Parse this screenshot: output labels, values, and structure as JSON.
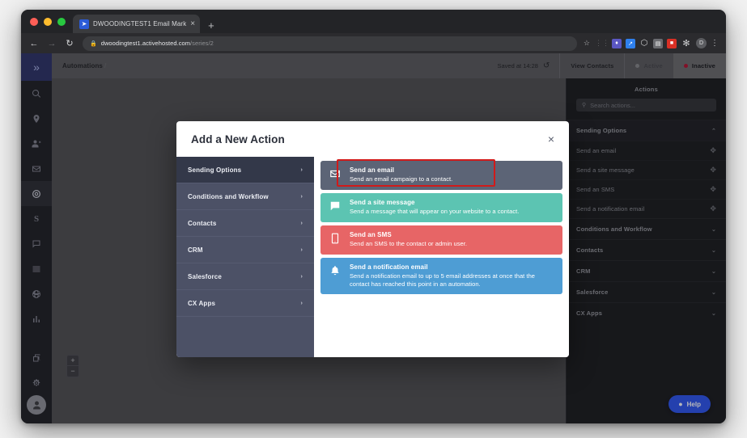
{
  "browser": {
    "tab": {
      "title": "DWOODINGTEST1 Email Mark",
      "favicon": "➤",
      "close": "×"
    },
    "new_tab": "+",
    "nav": {
      "back": "←",
      "forward": "→",
      "reload": "↻"
    },
    "omnibox": {
      "lock": "🔒",
      "domain": "dwoodingtest1.activehosted.com",
      "path": "/series/2"
    },
    "star": "☆",
    "extensions": [
      {
        "name": "extension-icon-1",
        "glyph": "◆",
        "cls": "e1"
      },
      {
        "name": "extension-icon-2",
        "glyph": "↗",
        "cls": "e2"
      },
      {
        "name": "extension-icon-3",
        "glyph": "⬡",
        "cls": "e3"
      },
      {
        "name": "extension-icon-4",
        "glyph": "▤",
        "cls": "e4"
      },
      {
        "name": "extension-icon-5",
        "glyph": "PDF",
        "cls": "e5"
      }
    ],
    "puzzle": "🧩",
    "profile_initial": "D",
    "kebab": "⋮"
  },
  "app_header": {
    "breadcrumb": "Automations",
    "breadcrumb_separator": "/",
    "saved_status": "Saved at 14:28",
    "history_icon": "↺",
    "view_contacts": "View Contacts",
    "active_label": "Active",
    "inactive_label": "Inactive"
  },
  "left_rail": {
    "logo": "»",
    "items": [
      {
        "name": "sidebar-icon-search",
        "glyph": "search"
      },
      {
        "name": "sidebar-icon-location",
        "glyph": "pin"
      },
      {
        "name": "sidebar-icon-contacts",
        "glyph": "contacts"
      },
      {
        "name": "sidebar-icon-campaigns",
        "glyph": "envelope"
      },
      {
        "name": "sidebar-icon-automations",
        "glyph": "target",
        "active": true
      },
      {
        "name": "sidebar-icon-deals",
        "glyph": "S"
      },
      {
        "name": "sidebar-icon-conversations",
        "glyph": "chat"
      },
      {
        "name": "sidebar-icon-lists",
        "glyph": "list"
      },
      {
        "name": "sidebar-icon-website",
        "glyph": "globe"
      },
      {
        "name": "sidebar-icon-reports",
        "glyph": "chart"
      }
    ],
    "bottom_items": [
      {
        "name": "sidebar-icon-apps",
        "glyph": "apps"
      },
      {
        "name": "sidebar-icon-settings",
        "glyph": "gear"
      }
    ],
    "avatar": "👤"
  },
  "canvas": {
    "zoom_in": "+",
    "zoom_out": "−"
  },
  "actions_panel": {
    "title": "Actions",
    "search_placeholder": "Search actions...",
    "search_icon": "⌕",
    "sections": [
      {
        "label": "Sending Options",
        "expanded": true,
        "chevron": "⌃",
        "items": [
          {
            "label": "Send an email"
          },
          {
            "label": "Send a site message"
          },
          {
            "label": "Send an SMS"
          },
          {
            "label": "Send a notification email"
          }
        ]
      },
      {
        "label": "Conditions and Workflow",
        "expanded": false,
        "chevron": "⌄",
        "items": []
      },
      {
        "label": "Contacts",
        "expanded": false,
        "chevron": "⌄",
        "items": []
      },
      {
        "label": "CRM",
        "expanded": false,
        "chevron": "⌄",
        "items": []
      },
      {
        "label": "Salesforce",
        "expanded": false,
        "chevron": "⌄",
        "items": []
      },
      {
        "label": "CX Apps",
        "expanded": false,
        "chevron": "⌄",
        "items": []
      }
    ],
    "drag_handle": "✥",
    "help_label": "Help",
    "help_icon": "○"
  },
  "modal": {
    "title": "Add a New Action",
    "close": "×",
    "nav_items": [
      {
        "label": "Sending Options",
        "selected": true
      },
      {
        "label": "Conditions and Workflow",
        "selected": false
      },
      {
        "label": "Contacts",
        "selected": false
      },
      {
        "label": "CRM",
        "selected": false
      },
      {
        "label": "Salesforce",
        "selected": false
      },
      {
        "label": "CX Apps",
        "selected": false
      }
    ],
    "nav_chevron": "›",
    "cards": [
      {
        "title": "Send an email",
        "desc": "Send an email campaign to a contact.",
        "color": "#5c6476",
        "icon": "envelope",
        "highlighted": true
      },
      {
        "title": "Send a site message",
        "desc": "Send a message that will appear on your website to a contact.",
        "color": "#5cc4b2",
        "icon": "chat-bubble",
        "highlighted": false
      },
      {
        "title": "Send an SMS",
        "desc": "Send an SMS to the contact or admin user.",
        "color": "#e76566",
        "icon": "phone",
        "highlighted": false
      },
      {
        "title": "Send a notification email",
        "desc": "Send a notification email to up to 5 email addresses at once that the contact has reached this point in an automation.",
        "color": "#4e9dd4",
        "icon": "bell",
        "highlighted": false
      }
    ]
  },
  "annotation": {
    "color": "#d11a1a"
  }
}
